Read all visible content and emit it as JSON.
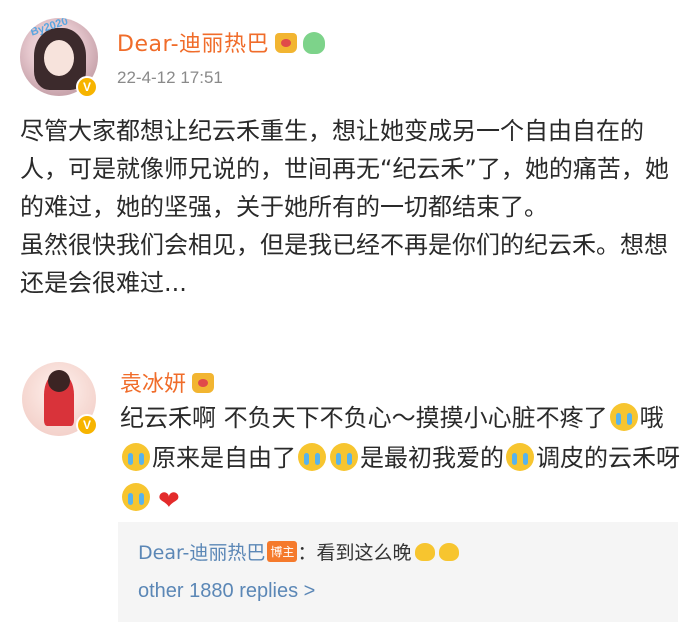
{
  "post": {
    "author": "Dear-迪丽热巴",
    "avatar_tag": "By2020",
    "timestamp": "22-4-12 17:51",
    "verified_badge": "V",
    "paragraphs": [
      "尽管大家都想让纪云禾重生，想让她变成另一个自由自在的人，可是就像师兄说的，世间再无“纪云禾”了，她的痛苦，她的难过，她的坚强，关于她所有的一切都结束了。",
      "虽然很快我们会相见，但是我已经不再是你们的纪云禾。想想还是会很难过..."
    ]
  },
  "reply": {
    "author": "袁冰妍",
    "verified_badge": "V",
    "segments": [
      "纪云禾啊 不负天下不负心～摸摸小心脏不疼了",
      "哦",
      "原来是自由了",
      "是最初我爱的",
      "调皮的云禾呀"
    ]
  },
  "subreply": {
    "author": "Dear-迪丽热巴",
    "author_badge": "博主",
    "text": "：看到这么晚",
    "more_link": "other 1880 replies >"
  },
  "icons": {
    "crown": "crown-icon",
    "cartoon": "cartoon-sticker-icon",
    "crying_emoji": "crying-emoji-icon",
    "heart": "heart-icon",
    "hug": "hug-emoji-icon"
  },
  "colors": {
    "username": "#f06c2a",
    "link": "#5b87b6",
    "timestamp": "#8a8a8a",
    "verified": "#f7b400"
  }
}
